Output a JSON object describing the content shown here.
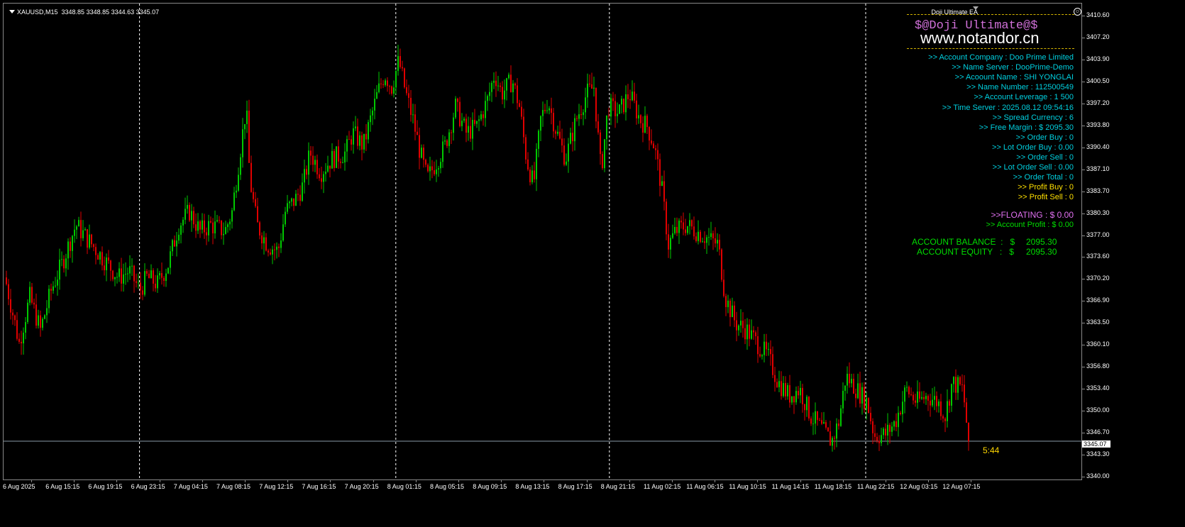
{
  "header": {
    "symbol": "XAUUSD,M15",
    "ohlc": "3348.85 3348.85 3344.63 3345.07",
    "ea_name": "Doji Ultimate EA",
    "ea_smiley": "☺"
  },
  "panel": {
    "brand_title": "$@Doji Ultimate@$",
    "watermark": "www.notandor.cn",
    "lines": [
      {
        "text": ">> Account Company  : Doo Prime Limited",
        "color": "cyan"
      },
      {
        "text": ">> Name Server  : DooPrime-Demo",
        "color": "cyan"
      },
      {
        "text": ">> Acoount Name  : SHI YONGLAI",
        "color": "cyan"
      },
      {
        "text": ">> Name Number  : 112500549",
        "color": "cyan"
      },
      {
        "text": ">> Account Leverage  : 1 500",
        "color": "cyan"
      },
      {
        "text": ">> Time Server  : 2025.08.12 09:54:16",
        "color": "cyan"
      },
      {
        "text": ">> Spread Currency  : 6",
        "color": "cyan"
      },
      {
        "text": ">> Free Margin  : $ 2095.30",
        "color": "cyan"
      },
      {
        "text": ">> Order Buy  : 0",
        "color": "cyan"
      },
      {
        "text": ">> Lot Order Buy  : 0.00",
        "color": "cyan"
      },
      {
        "text": ">> Order Sell  : 0",
        "color": "cyan"
      },
      {
        "text": ">> Lot Order Sell  : 0.00",
        "color": "cyan"
      },
      {
        "text": ">> Order Total  : 0",
        "color": "cyan"
      },
      {
        "text": ">> Profit Buy  : 0",
        "color": "yellow"
      },
      {
        "text": ">> Profit Sell  : 0",
        "color": "yellow"
      }
    ],
    "floating": ">>FLOATING  : $ 0.00",
    "account_profit": ">> Account Profit  : $ 0.00",
    "balance_label": "ACCOUNT BALANCE  :   $",
    "balance_value": "2095.30",
    "equity_label": "ACCOUNT EQUITY   :   $",
    "equity_value": "2095.30"
  },
  "countdown": "5:44",
  "current_price": "3345.07",
  "colors": {
    "bull": "#00c800",
    "bear": "#e00000",
    "cyan": "#00d0e0",
    "yellow": "#ffe000",
    "magenta": "#e070f0",
    "green": "#00dd00",
    "separator": "#ffffff",
    "price_line": "#8a9aa8"
  },
  "chart_data": {
    "type": "candlestick",
    "price_ticks": [
      "3410.60",
      "3407.20",
      "3403.90",
      "3400.50",
      "3397.20",
      "3393.80",
      "3390.40",
      "3387.10",
      "3383.70",
      "3380.30",
      "3377.00",
      "3373.60",
      "3370.20",
      "3366.90",
      "3363.50",
      "3360.10",
      "3356.80",
      "3353.40",
      "3350.00",
      "3346.70",
      "3343.30",
      "3340.00"
    ],
    "time_ticks": [
      "6 Aug 2025",
      "6 Aug 15:15",
      "6 Aug 19:15",
      "6 Aug 23:15",
      "7 Aug 04:15",
      "7 Aug 08:15",
      "7 Aug 12:15",
      "7 Aug 16:15",
      "7 Aug 20:15",
      "8 Aug 01:15",
      "8 Aug 05:15",
      "8 Aug 09:15",
      "8 Aug 13:15",
      "8 Aug 17:15",
      "8 Aug 21:15",
      "11 Aug 02:15",
      "11 Aug 06:15",
      "11 Aug 10:15",
      "11 Aug 14:15",
      "11 Aug 18:15",
      "11 Aug 22:15",
      "12 Aug 03:15",
      "12 Aug 07:15"
    ],
    "day_separators": [
      "6 Aug 23:15",
      "8 Aug 01:15",
      "8 Aug 21:15",
      "11 Aug 22:15"
    ],
    "y_min": 3340.0,
    "y_max": 3410.6,
    "current_price": 3345.07,
    "close_path": [
      [
        0,
        3370
      ],
      [
        10,
        3365
      ],
      [
        20,
        3360
      ],
      [
        35,
        3367
      ],
      [
        50,
        3362
      ],
      [
        65,
        3368
      ],
      [
        80,
        3372
      ],
      [
        100,
        3378
      ],
      [
        115,
        3376
      ],
      [
        130,
        3374
      ],
      [
        145,
        3372
      ],
      [
        160,
        3370
      ],
      [
        175,
        3371
      ],
      [
        190,
        3368
      ],
      [
        200,
        3370
      ],
      [
        215,
        3369
      ],
      [
        230,
        3372
      ],
      [
        245,
        3378
      ],
      [
        260,
        3380
      ],
      [
        275,
        3377
      ],
      [
        290,
        3378
      ],
      [
        310,
        3377
      ],
      [
        320,
        3380
      ],
      [
        330,
        3388
      ],
      [
        340,
        3396
      ],
      [
        345,
        3385
      ],
      [
        355,
        3378
      ],
      [
        370,
        3375
      ],
      [
        385,
        3374
      ],
      [
        395,
        3380
      ],
      [
        410,
        3382
      ],
      [
        420,
        3384
      ],
      [
        430,
        3389
      ],
      [
        445,
        3386
      ],
      [
        460,
        3388
      ],
      [
        480,
        3389
      ],
      [
        490,
        3392
      ],
      [
        505,
        3390
      ],
      [
        515,
        3394
      ],
      [
        525,
        3398
      ],
      [
        535,
        3401
      ],
      [
        545,
        3399
      ],
      [
        555,
        3403
      ],
      [
        565,
        3398
      ],
      [
        575,
        3394
      ],
      [
        585,
        3389
      ],
      [
        595,
        3385
      ],
      [
        605,
        3387
      ],
      [
        620,
        3390
      ],
      [
        635,
        3396
      ],
      [
        650,
        3392
      ],
      [
        665,
        3393
      ],
      [
        680,
        3397
      ],
      [
        690,
        3401
      ],
      [
        700,
        3398
      ],
      [
        715,
        3400
      ],
      [
        725,
        3396
      ],
      [
        735,
        3388
      ],
      [
        745,
        3384
      ],
      [
        755,
        3394
      ],
      [
        765,
        3397
      ],
      [
        775,
        3393
      ],
      [
        790,
        3388
      ],
      [
        805,
        3394
      ],
      [
        820,
        3398
      ],
      [
        830,
        3399
      ],
      [
        840,
        3386
      ],
      [
        850,
        3396
      ],
      [
        865,
        3395
      ],
      [
        880,
        3398
      ],
      [
        895,
        3394
      ],
      [
        905,
        3393
      ],
      [
        915,
        3390
      ],
      [
        925,
        3384
      ],
      [
        935,
        3375
      ],
      [
        945,
        3377
      ],
      [
        960,
        3378
      ],
      [
        975,
        3377
      ],
      [
        990,
        3376
      ],
      [
        1005,
        3375
      ],
      [
        1015,
        3367
      ],
      [
        1030,
        3363
      ],
      [
        1045,
        3362
      ],
      [
        1060,
        3360
      ],
      [
        1075,
        3358
      ],
      [
        1090,
        3354
      ],
      [
        1105,
        3352
      ],
      [
        1120,
        3353
      ],
      [
        1135,
        3349
      ],
      [
        1150,
        3347
      ],
      [
        1165,
        3345
      ],
      [
        1175,
        3348
      ],
      [
        1185,
        3355
      ],
      [
        1200,
        3353
      ],
      [
        1215,
        3351
      ],
      [
        1225,
        3346
      ],
      [
        1240,
        3346
      ],
      [
        1255,
        3348
      ],
      [
        1270,
        3353
      ],
      [
        1285,
        3351
      ],
      [
        1300,
        3352
      ],
      [
        1315,
        3351
      ],
      [
        1325,
        3349
      ],
      [
        1335,
        3354
      ],
      [
        1350,
        3353
      ],
      [
        1358,
        3345.07
      ]
    ]
  }
}
